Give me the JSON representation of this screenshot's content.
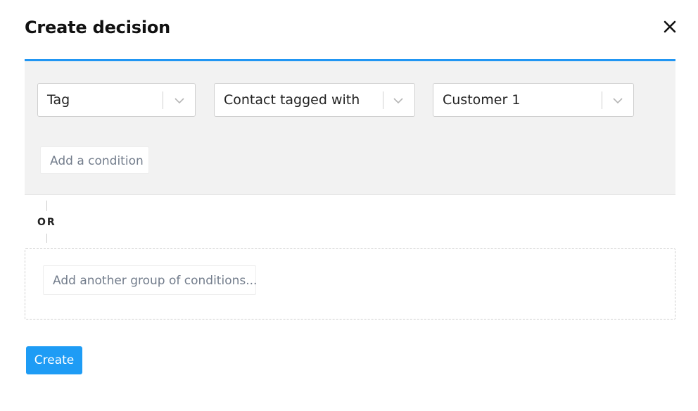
{
  "modal": {
    "title": "Create decision",
    "close_icon": "close-icon"
  },
  "conditions": [
    {
      "value": "Tag",
      "icon": "chevron-down-icon"
    },
    {
      "value": "Contact tagged with",
      "icon": "chevron-down-icon"
    },
    {
      "value": "Customer 1",
      "icon": "chevron-down-icon"
    }
  ],
  "group": {
    "add_condition_label": "Add a condition",
    "accent_color": "#2196f3"
  },
  "separator": {
    "label": "OR"
  },
  "empty_group": {
    "add_group_label": "Add another group of conditions..."
  },
  "footer": {
    "create_label": "Create",
    "create_color": "#1e9cf5"
  }
}
